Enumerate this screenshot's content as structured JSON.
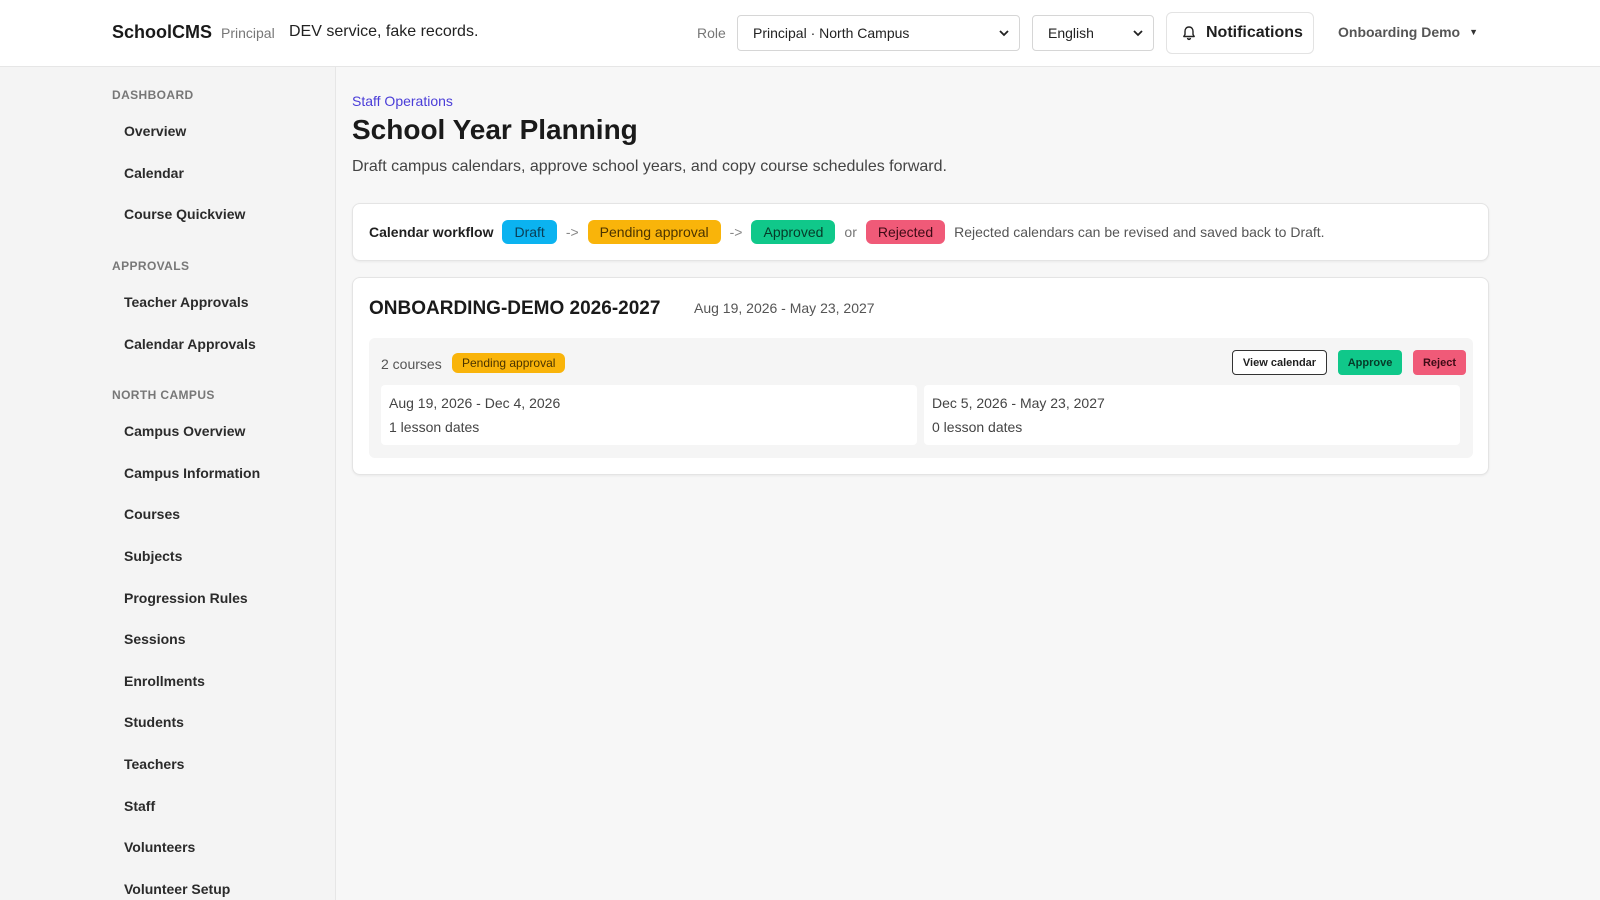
{
  "header": {
    "brand": "SchoolCMS",
    "role_tag": "Principal",
    "dev_note": "DEV service, fake records.",
    "role_label": "Role",
    "role_select": "Principal · North Campus",
    "language_select": "English",
    "notifications_label": "Notifications",
    "user_menu": "Onboarding Demo"
  },
  "sidebar": {
    "sections": [
      {
        "title": "DASHBOARD",
        "items": [
          "Overview",
          "Calendar",
          "Course Quickview"
        ]
      },
      {
        "title": "APPROVALS",
        "items": [
          "Teacher Approvals",
          "Calendar Approvals"
        ]
      },
      {
        "title": "NORTH CAMPUS",
        "items": [
          "Campus Overview",
          "Campus Information",
          "Courses",
          "Subjects",
          "Progression Rules",
          "Sessions",
          "Enrollments",
          "Students",
          "Teachers",
          "Staff",
          "Volunteers",
          "Volunteer Setup"
        ]
      }
    ]
  },
  "main": {
    "breadcrumb": "Staff Operations",
    "title": "School Year Planning",
    "subtitle": "Draft campus calendars, approve school years, and copy course schedules forward.",
    "workflow": {
      "label": "Calendar workflow",
      "draft": "Draft",
      "arrow": "->",
      "pending": "Pending approval",
      "approved": "Approved",
      "or": "or",
      "rejected": "Rejected",
      "note": "Rejected calendars can be revised and saved back to Draft."
    },
    "school_year": {
      "title": "ONBOARDING-DEMO 2026-2027",
      "range": "Aug 19, 2026 - May 23, 2027",
      "course_count": "2 courses",
      "status": "Pending approval",
      "view_button": "View calendar",
      "approve_button": "Approve",
      "reject_button": "Reject",
      "terms": [
        {
          "dates": "Aug 19, 2026 - Dec 4, 2026",
          "lessons": "1 lesson dates"
        },
        {
          "dates": "Dec 5, 2026 - May 23, 2027",
          "lessons": "0 lesson dates"
        }
      ]
    }
  }
}
